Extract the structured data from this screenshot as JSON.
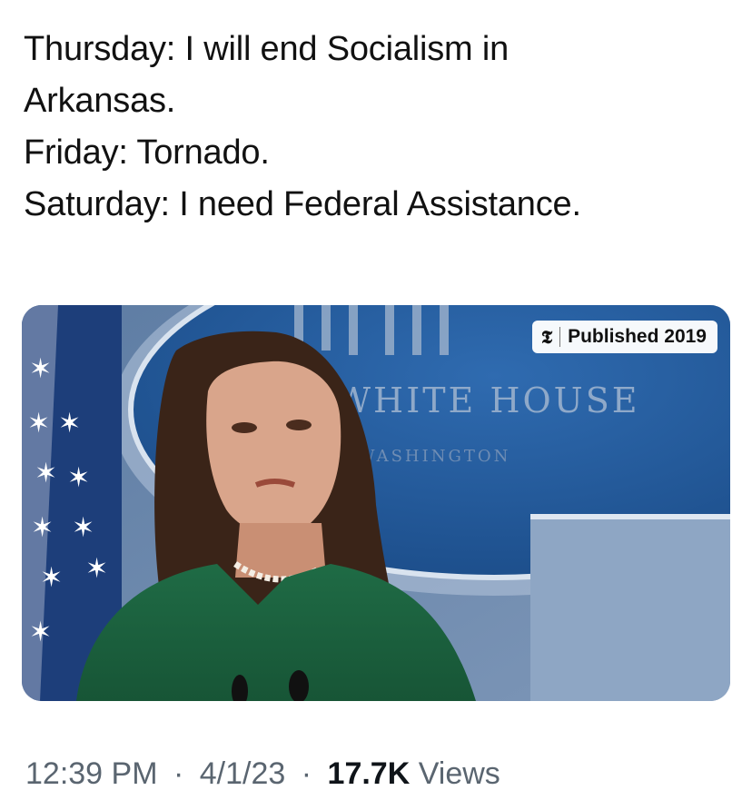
{
  "tweet": {
    "lines": [
      "Thursday: I will end Socialism in",
      "Arkansas.",
      "Friday: Tornado.",
      "Saturday: I need Federal Assistance."
    ]
  },
  "media": {
    "badge_logo": "𝕿",
    "badge_text": "Published 2019",
    "sign_line1": "WHITE HOUSE",
    "sign_line2": "WASHINGTON"
  },
  "meta": {
    "time": "12:39 PM",
    "separator": "·",
    "date": "4/1/23",
    "views_count": "17.7K",
    "views_label": "Views"
  },
  "colors": {
    "text": "#111111",
    "meta_text": "#5a6570",
    "green_top": "#1f6b45"
  }
}
